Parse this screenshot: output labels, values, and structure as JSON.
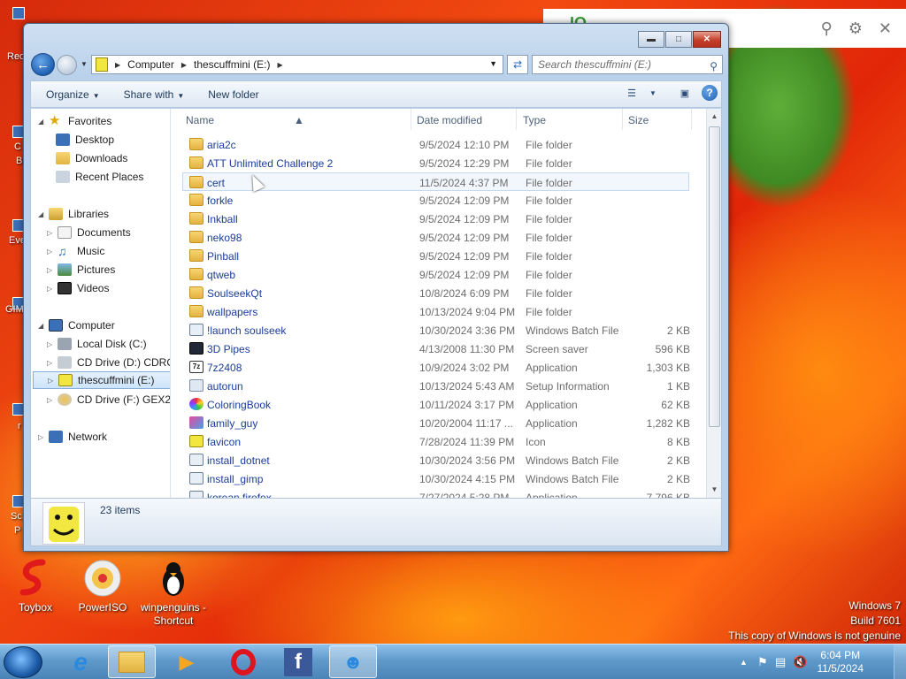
{
  "search_overlay": {
    "brand_text": "IO"
  },
  "desktop": {
    "edge_labels": [
      "Rec",
      "C",
      "B",
      "Eve",
      "GIM",
      "r",
      "Sc",
      "P"
    ],
    "icons": [
      {
        "label": "Toybox",
        "icon": "toybox-icon"
      },
      {
        "label": "PowerISO",
        "icon": "poweriso-icon"
      },
      {
        "label": "winpenguins - Shortcut",
        "icon": "penguin-icon"
      }
    ]
  },
  "explorer": {
    "breadcrumb": [
      "Computer",
      "thescuffmini (E:)"
    ],
    "search_placeholder": "Search thescuffmini (E:)",
    "toolbar": {
      "organize": "Organize",
      "share_with": "Share with",
      "new_folder": "New folder"
    },
    "nav": {
      "favorites": "Favorites",
      "favorite_items": [
        "Desktop",
        "Downloads",
        "Recent Places"
      ],
      "libraries": "Libraries",
      "library_items": [
        "Documents",
        "Music",
        "Pictures",
        "Videos"
      ],
      "computer": "Computer",
      "computer_items": [
        "Local Disk (C:)",
        "CD Drive (D:) CDROM",
        "thescuffmini (E:)",
        "CD Drive (F:) GEX2_D"
      ],
      "network": "Network"
    },
    "columns": {
      "name": "Name",
      "date": "Date modified",
      "type": "Type",
      "size": "Size"
    },
    "files": [
      {
        "name": "aria2c",
        "date": "9/5/2024 12:10 PM",
        "type": "File folder",
        "size": "",
        "icon": "folder"
      },
      {
        "name": "ATT Unlimited Challenge 2",
        "date": "9/5/2024 12:29 PM",
        "type": "File folder",
        "size": "",
        "icon": "folder"
      },
      {
        "name": "cert",
        "date": "11/5/2024 4:37 PM",
        "type": "File folder",
        "size": "",
        "icon": "folder"
      },
      {
        "name": "forkle",
        "date": "9/5/2024 12:09 PM",
        "type": "File folder",
        "size": "",
        "icon": "folder"
      },
      {
        "name": "Inkball",
        "date": "9/5/2024 12:09 PM",
        "type": "File folder",
        "size": "",
        "icon": "folder"
      },
      {
        "name": "neko98",
        "date": "9/5/2024 12:09 PM",
        "type": "File folder",
        "size": "",
        "icon": "folder"
      },
      {
        "name": "Pinball",
        "date": "9/5/2024 12:09 PM",
        "type": "File folder",
        "size": "",
        "icon": "folder"
      },
      {
        "name": "qtweb",
        "date": "9/5/2024 12:09 PM",
        "type": "File folder",
        "size": "",
        "icon": "folder"
      },
      {
        "name": "SoulseekQt",
        "date": "10/8/2024 6:09 PM",
        "type": "File folder",
        "size": "",
        "icon": "folder"
      },
      {
        "name": "wallpapers",
        "date": "10/13/2024 9:04 PM",
        "type": "File folder",
        "size": "",
        "icon": "folder"
      },
      {
        "name": "!launch soulseek",
        "date": "10/30/2024 3:36 PM",
        "type": "Windows Batch File",
        "size": "2 KB",
        "icon": "bat"
      },
      {
        "name": "3D Pipes",
        "date": "4/13/2008 11:30 PM",
        "type": "Screen saver",
        "size": "596 KB",
        "icon": "scr"
      },
      {
        "name": "7z2408",
        "date": "10/9/2024 3:02 PM",
        "type": "Application",
        "size": "1,303 KB",
        "icon": "app7z"
      },
      {
        "name": "autorun",
        "date": "10/13/2024 5:43 AM",
        "type": "Setup Information",
        "size": "1 KB",
        "icon": "inf"
      },
      {
        "name": "ColoringBook",
        "date": "10/11/2024 3:17 PM",
        "type": "Application",
        "size": "62 KB",
        "icon": "color"
      },
      {
        "name": "family_guy",
        "date": "10/20/2004 11:17 ...",
        "type": "Application",
        "size": "1,282 KB",
        "icon": "fam"
      },
      {
        "name": "favicon",
        "date": "7/28/2024 11:39 PM",
        "type": "Icon",
        "size": "8 KB",
        "icon": "ico"
      },
      {
        "name": "install_dotnet",
        "date": "10/30/2024 3:56 PM",
        "type": "Windows Batch File",
        "size": "2 KB",
        "icon": "bat"
      },
      {
        "name": "install_gimp",
        "date": "10/30/2024 4:15 PM",
        "type": "Windows Batch File",
        "size": "2 KB",
        "icon": "bat"
      },
      {
        "name": "korean firefox",
        "date": "7/27/2024 5:28 PM",
        "type": "Application",
        "size": "7,796 KB",
        "icon": "bat"
      }
    ],
    "item_count": "23 items"
  },
  "watermark": {
    "line1": "Windows 7",
    "line2": "Build 7601",
    "line3": "This copy of Windows is not genuine"
  },
  "taskbar": {
    "time": "6:04 PM",
    "date": "11/5/2024"
  }
}
